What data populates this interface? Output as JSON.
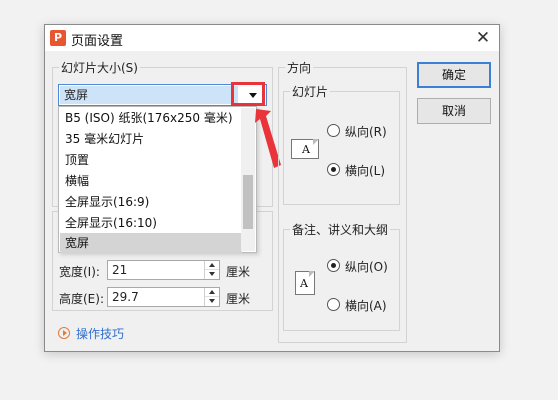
{
  "dialog": {
    "title": "页面设置",
    "app_icon_letter": "P",
    "close_symbol": "✕"
  },
  "slide_size": {
    "label": "幻灯片大小(S)",
    "selected": "宽屏",
    "dropdown_items": [
      "B5 (ISO) 纸张(176x250 毫米)",
      "35 毫米幻灯片",
      "顶置",
      "横幅",
      "全屏显示(16:9)",
      "全屏显示(16:10)",
      "宽屏"
    ],
    "selected_index": 6,
    "width_label": "宽度(I):",
    "width_value": "21",
    "height_label": "高度(E):",
    "height_value": "29.7",
    "unit": "厘米"
  },
  "orientation": {
    "label": "方向",
    "slides": {
      "label": "幻灯片",
      "portrait": "纵向(R)",
      "landscape": "横向(L)",
      "selected": "landscape"
    },
    "notes": {
      "label": "备注、讲义和大纲",
      "portrait": "纵向(O)",
      "landscape": "横向(A)",
      "selected": "portrait"
    },
    "page_icon_letter": "A"
  },
  "buttons": {
    "ok": "确定",
    "cancel": "取消"
  },
  "tips": {
    "label": "操作技巧"
  },
  "colors": {
    "accent": "#3c7fd6",
    "highlight_red": "#e8343a",
    "link": "#2f6fd0",
    "app_icon": "#e8552e"
  }
}
